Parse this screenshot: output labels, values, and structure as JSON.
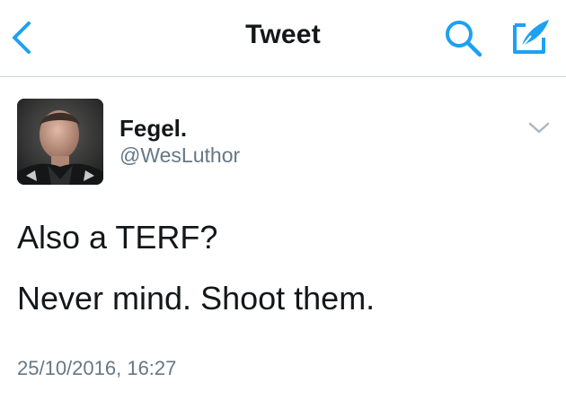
{
  "nav": {
    "title": "Tweet",
    "back_icon": "chevron-left-icon",
    "search_icon": "search-icon",
    "compose_icon": "compose-icon"
  },
  "tweet": {
    "author_name": "Fegel.",
    "author_handle": "@WesLuthor",
    "lines": [
      "Also a TERF?",
      "Never mind. Shoot them."
    ],
    "timestamp": "25/10/2016, 16:27",
    "menu_icon": "chevron-down-icon"
  },
  "colors": {
    "accent": "#1da1f2",
    "text": "#14171a",
    "secondary": "#657786",
    "divider": "#cfd4d9"
  }
}
